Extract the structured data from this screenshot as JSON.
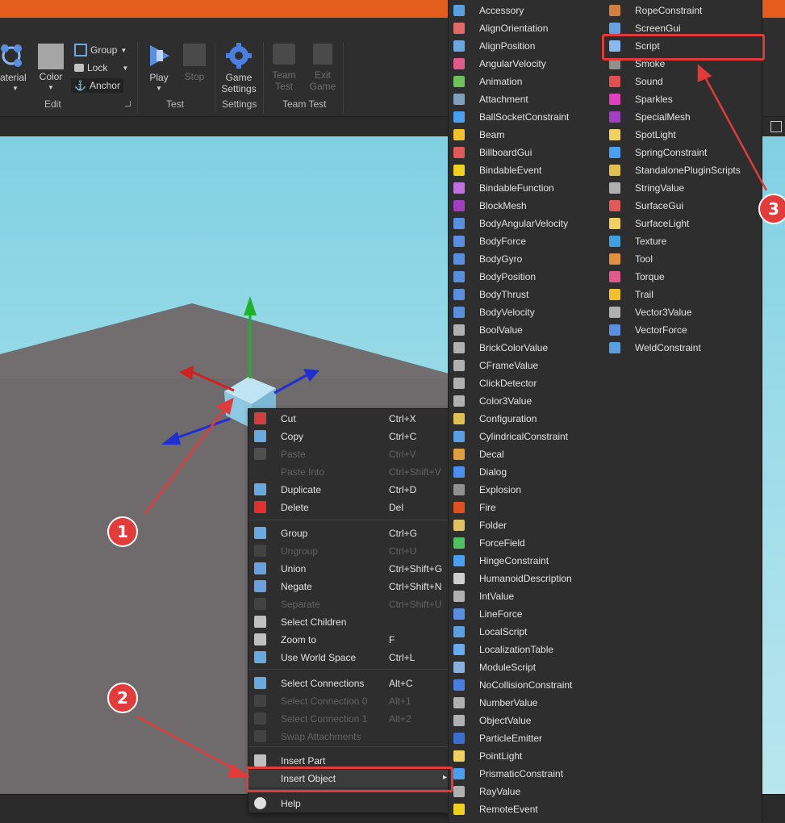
{
  "ribbon": {
    "material_label": "aterial",
    "color_label": "Color",
    "group_label": "Group",
    "lock_label": "Lock",
    "anchor_label": "Anchor",
    "edit_section": "Edit",
    "play_label": "Play",
    "stop_label": "Stop",
    "test_section": "Test",
    "game_settings_line1": "Game",
    "game_settings_line2": "Settings",
    "settings_section": "Settings",
    "team_test_line1": "Team",
    "team_test_line2": "Test",
    "exit_game_line1": "Exit",
    "exit_game_line2": "Game",
    "team_test_section": "Team Test"
  },
  "context_menu": {
    "items": [
      {
        "label": "Cut",
        "shortcut": "Ctrl+X",
        "icon": "scissors-icon",
        "disabled": false
      },
      {
        "label": "Copy",
        "shortcut": "Ctrl+C",
        "icon": "copy-icon",
        "disabled": false
      },
      {
        "label": "Paste",
        "shortcut": "Ctrl+V",
        "icon": "paste-icon",
        "disabled": true
      },
      {
        "label": "Paste Into",
        "shortcut": "Ctrl+Shift+V",
        "icon": "",
        "disabled": true
      },
      {
        "label": "Duplicate",
        "shortcut": "Ctrl+D",
        "icon": "duplicate-icon",
        "disabled": false
      },
      {
        "label": "Delete",
        "shortcut": "Del",
        "icon": "delete-icon",
        "disabled": false
      },
      {
        "label": "Group",
        "shortcut": "Ctrl+G",
        "icon": "group-icon",
        "disabled": false
      },
      {
        "label": "Ungroup",
        "shortcut": "Ctrl+U",
        "icon": "ungroup-icon",
        "disabled": true
      },
      {
        "label": "Union",
        "shortcut": "Ctrl+Shift+G",
        "icon": "union-icon",
        "disabled": false
      },
      {
        "label": "Negate",
        "shortcut": "Ctrl+Shift+N",
        "icon": "negate-icon",
        "disabled": false
      },
      {
        "label": "Separate",
        "shortcut": "Ctrl+Shift+U",
        "icon": "separate-icon",
        "disabled": true
      },
      {
        "label": "Select Children",
        "shortcut": "",
        "icon": "select-children-icon",
        "disabled": false
      },
      {
        "label": "Zoom to",
        "shortcut": "F",
        "icon": "zoom-to-icon",
        "disabled": false
      },
      {
        "label": "Use World Space",
        "shortcut": "Ctrl+L",
        "icon": "world-space-icon",
        "disabled": false
      },
      {
        "label": "Select Connections",
        "shortcut": "Alt+C",
        "icon": "select-connections-icon",
        "disabled": false
      },
      {
        "label": "Select Connection 0",
        "shortcut": "Alt+1",
        "icon": "connection-icon",
        "disabled": true
      },
      {
        "label": "Select Connection 1",
        "shortcut": "Alt+2",
        "icon": "connection-icon",
        "disabled": true
      },
      {
        "label": "Swap Attachments",
        "shortcut": "",
        "icon": "swap-icon",
        "disabled": true
      },
      {
        "label": "Insert Part",
        "shortcut": "",
        "icon": "part-icon",
        "disabled": false
      },
      {
        "label": "Insert Object",
        "shortcut": "",
        "icon": "",
        "disabled": false
      },
      {
        "label": "Help",
        "shortcut": "",
        "icon": "help-icon",
        "disabled": false
      }
    ]
  },
  "insert_menu": {
    "left": [
      {
        "label": "Accessory",
        "color": "#5aa0e0"
      },
      {
        "label": "AlignOrientation",
        "color": "#e06a6a"
      },
      {
        "label": "AlignPosition",
        "color": "#6aa8e0"
      },
      {
        "label": "AngularVelocity",
        "color": "#e05a8a"
      },
      {
        "label": "Animation",
        "color": "#6fbf5a"
      },
      {
        "label": "Attachment",
        "color": "#7f9fbf"
      },
      {
        "label": "BallSocketConstraint",
        "color": "#4a9ff0"
      },
      {
        "label": "Beam",
        "color": "#f0c030"
      },
      {
        "label": "BillboardGui",
        "color": "#e05a5a"
      },
      {
        "label": "BindableEvent",
        "color": "#f0d020"
      },
      {
        "label": "BindableFunction",
        "color": "#c070e0"
      },
      {
        "label": "BlockMesh",
        "color": "#a040c0"
      },
      {
        "label": "BodyAngularVelocity",
        "color": "#5a8fe0"
      },
      {
        "label": "BodyForce",
        "color": "#5a8fe0"
      },
      {
        "label": "BodyGyro",
        "color": "#5a8fe0"
      },
      {
        "label": "BodyPosition",
        "color": "#5a8fe0"
      },
      {
        "label": "BodyThrust",
        "color": "#5a8fe0"
      },
      {
        "label": "BodyVelocity",
        "color": "#5a8fe0"
      },
      {
        "label": "BoolValue",
        "color": "#b0b0b0"
      },
      {
        "label": "BrickColorValue",
        "color": "#b0b0b0"
      },
      {
        "label": "CFrameValue",
        "color": "#b0b0b0"
      },
      {
        "label": "ClickDetector",
        "color": "#b0b0b0"
      },
      {
        "label": "Color3Value",
        "color": "#b0b0b0"
      },
      {
        "label": "Configuration",
        "color": "#e0c050"
      },
      {
        "label": "CylindricalConstraint",
        "color": "#5a9fe0"
      },
      {
        "label": "Decal",
        "color": "#e0a040"
      },
      {
        "label": "Dialog",
        "color": "#4a8ff0"
      },
      {
        "label": "Explosion",
        "color": "#909090"
      },
      {
        "label": "Fire",
        "color": "#e05020"
      },
      {
        "label": "Folder",
        "color": "#e0c060"
      },
      {
        "label": "ForceField",
        "color": "#50c060"
      },
      {
        "label": "HingeConstraint",
        "color": "#4a9ff0"
      },
      {
        "label": "HumanoidDescription",
        "color": "#d0d0d0"
      },
      {
        "label": "IntValue",
        "color": "#b0b0b0"
      },
      {
        "label": "LineForce",
        "color": "#5a8fe0"
      },
      {
        "label": "LocalScript",
        "color": "#5a9fe0"
      },
      {
        "label": "LocalizationTable",
        "color": "#6aaaf0"
      },
      {
        "label": "ModuleScript",
        "color": "#8ab0e0"
      },
      {
        "label": "NoCollisionConstraint",
        "color": "#4a7fe0"
      },
      {
        "label": "NumberValue",
        "color": "#b0b0b0"
      },
      {
        "label": "ObjectValue",
        "color": "#b0b0b0"
      },
      {
        "label": "ParticleEmitter",
        "color": "#3a6fd0"
      },
      {
        "label": "PointLight",
        "color": "#f0d060"
      },
      {
        "label": "PrismaticConstraint",
        "color": "#4a9ff0"
      },
      {
        "label": "RayValue",
        "color": "#b0b0b0"
      },
      {
        "label": "RemoteEvent",
        "color": "#f0d020"
      }
    ],
    "right": [
      {
        "label": "RopeConstraint",
        "color": "#d08040"
      },
      {
        "label": "ScreenGui",
        "color": "#6a9fe0"
      },
      {
        "label": "Script",
        "color": "#8ab8f0"
      },
      {
        "label": "Smoke",
        "color": "#909090"
      },
      {
        "label": "Sound",
        "color": "#e05050"
      },
      {
        "label": "Sparkles",
        "color": "#e040c0"
      },
      {
        "label": "SpecialMesh",
        "color": "#a040c0"
      },
      {
        "label": "SpotLight",
        "color": "#f0d060"
      },
      {
        "label": "SpringConstraint",
        "color": "#4a9ff0"
      },
      {
        "label": "StandalonePluginScripts",
        "color": "#e0c050"
      },
      {
        "label": "StringValue",
        "color": "#b0b0b0"
      },
      {
        "label": "SurfaceGui",
        "color": "#e05a5a"
      },
      {
        "label": "SurfaceLight",
        "color": "#f0d060"
      },
      {
        "label": "Texture",
        "color": "#40a0e0"
      },
      {
        "label": "Tool",
        "color": "#e09040"
      },
      {
        "label": "Torque",
        "color": "#e05a8a"
      },
      {
        "label": "Trail",
        "color": "#f0c030"
      },
      {
        "label": "Vector3Value",
        "color": "#b0b0b0"
      },
      {
        "label": "VectorForce",
        "color": "#5a8fe0"
      },
      {
        "label": "WeldConstraint",
        "color": "#5a9fe0"
      }
    ]
  },
  "annotations": {
    "badge1": "1",
    "badge2": "2",
    "badge3": "3",
    "accent": "#e03a3a"
  }
}
